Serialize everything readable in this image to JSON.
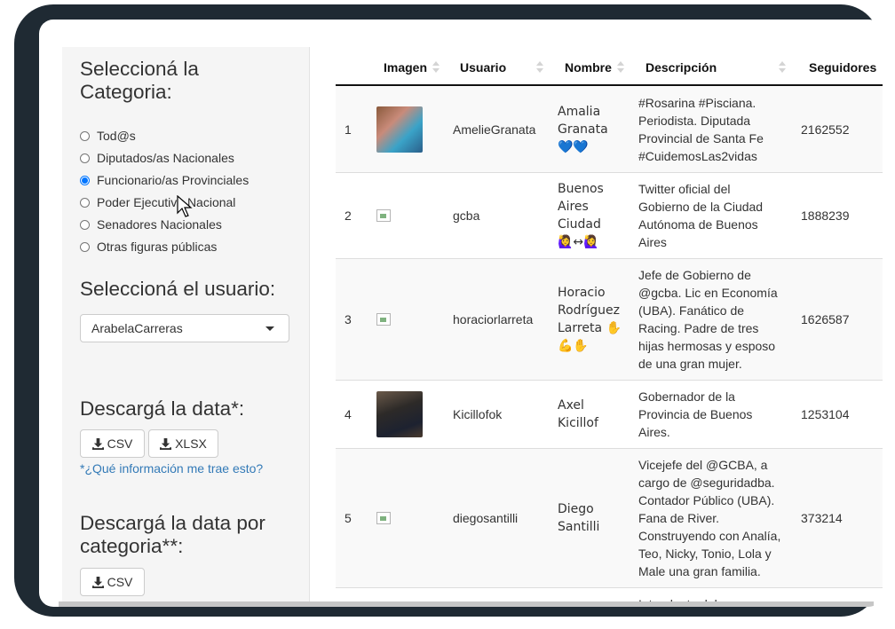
{
  "sidebar": {
    "category_heading": "Seleccioná la Categoria:",
    "categories": [
      {
        "label": "Tod@s",
        "checked": false
      },
      {
        "label": "Diputados/as Nacionales",
        "checked": false
      },
      {
        "label": "Funcionario/as Provinciales",
        "checked": true
      },
      {
        "label": "Poder Ejecutivo Nacional",
        "checked": false
      },
      {
        "label": "Senadores Nacionales",
        "checked": false
      },
      {
        "label": "Otras figuras públicas",
        "checked": false
      }
    ],
    "user_heading": "Seleccioná el usuario:",
    "user_select_value": "ArabelaCarreras",
    "download_heading": "Descargá la data*:",
    "csv_label": "CSV",
    "xlsx_label": "XLSX",
    "info_link": "*¿Qué información me trae esto?",
    "download_cat_heading": "Descargá la data por categoria**:",
    "csv2_label": "CSV"
  },
  "table": {
    "headers": [
      "Imagen",
      "Usuario",
      "Nombre",
      "Descripción",
      "Seguidores"
    ],
    "rows": [
      {
        "num": "1",
        "user": "AmelieGranata",
        "name_lines": [
          "Amalia",
          "Granata",
          "💙💙"
        ],
        "desc_lines": [
          "#Rosarina #Pisciana.",
          "Periodista. Diputada",
          "Provincial de Santa Fe",
          "#CuidemosLas2vidas"
        ],
        "followers": "2162552",
        "image": "photo"
      },
      {
        "num": "2",
        "user": "gcba",
        "name_lines": [
          "Buenos",
          "Aires",
          "Ciudad",
          "🙋‍♀️↔🙋‍♀️"
        ],
        "desc_lines": [
          "Twitter oficial del",
          "Gobierno de la Ciudad",
          "Autónoma de Buenos",
          "Aires"
        ],
        "followers": "1888239",
        "image": "broken"
      },
      {
        "num": "3",
        "user": "horaciorlarreta",
        "name_lines": [
          "Horacio",
          "Rodríguez",
          "Larreta ✋",
          "💪✋"
        ],
        "desc_lines": [
          "Jefe de Gobierno de",
          "@gcba. Lic en Economía",
          "(UBA). Fanático de",
          "Racing. Padre de tres",
          "hijas hermosas y esposo",
          "de una gran mujer."
        ],
        "followers": "1626587",
        "image": "broken"
      },
      {
        "num": "4",
        "user": "Kicillofok",
        "name_lines": [
          "Axel",
          "Kicillof"
        ],
        "desc_lines": [
          "Gobernador de la",
          "Provincia de Buenos",
          "Aires."
        ],
        "followers": "1253104",
        "image": "photo"
      },
      {
        "num": "5",
        "user": "diegosantilli",
        "name_lines": [
          "Diego",
          "Santilli"
        ],
        "desc_lines": [
          "Vicejefe del @GCBA, a",
          "cargo de @seguridadba.",
          "Contador Público (UBA).",
          "Fana de River.",
          "Construyendo con Analía,",
          "Teo, Nicky, Tonio, Lola y",
          "Male una gran familia."
        ],
        "followers": "373214",
        "image": "broken"
      },
      {
        "num": "",
        "user": "",
        "name_lines": [],
        "desc_lines": [
          "Intendente del"
        ],
        "followers": "",
        "image": "none"
      }
    ]
  },
  "colors": {
    "radio_accent": "#0075ff",
    "link": "#337ab7",
    "frame": "#1f2a33"
  }
}
